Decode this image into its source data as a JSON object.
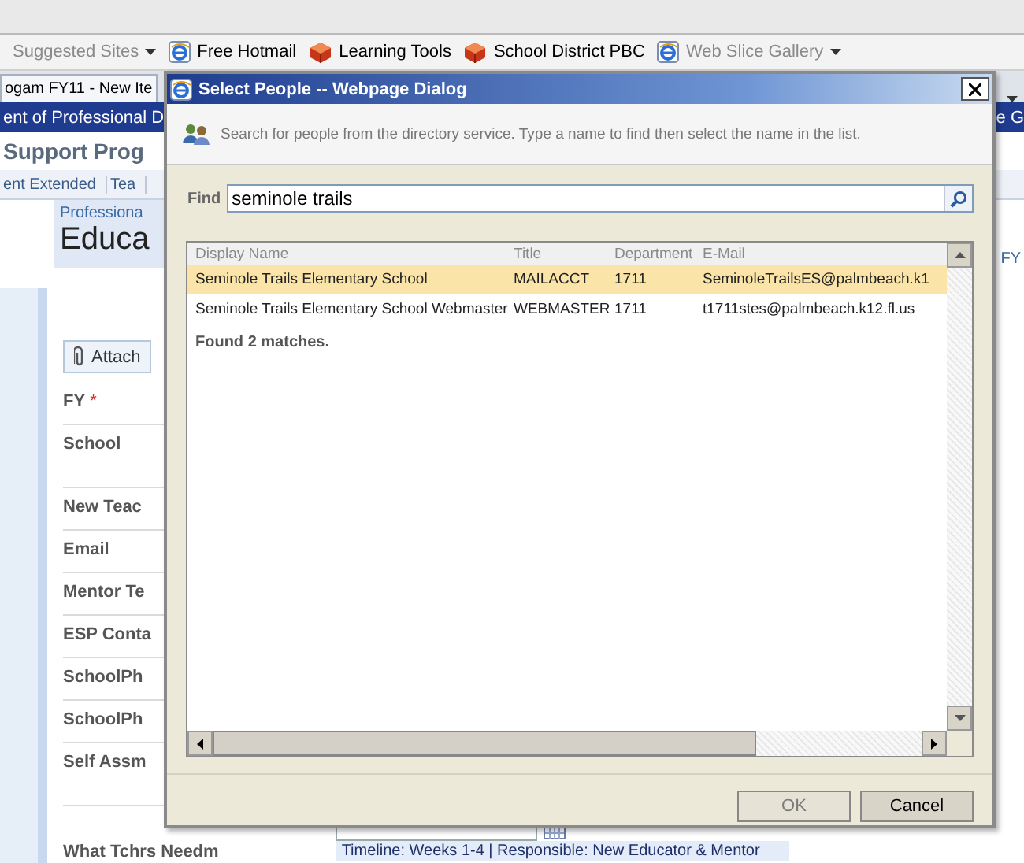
{
  "favorites_bar": {
    "items": [
      {
        "label": "Suggested Sites",
        "dimmed": true,
        "menu": true
      },
      {
        "label": "Free Hotmail",
        "dimmed": false,
        "kind": "browser",
        "menu": false
      },
      {
        "label": "Learning Tools",
        "dimmed": false,
        "kind": "cube",
        "menu": false
      },
      {
        "label": "School District PBC",
        "dimmed": false,
        "kind": "cube",
        "menu": false
      },
      {
        "label": "Web Slice Gallery",
        "dimmed": true,
        "kind": "browser",
        "menu": true
      }
    ]
  },
  "browser_tab": {
    "label": "ogam FY11 - New Ite"
  },
  "site_bar": {
    "left": "ent of Professional D",
    "right": "e G"
  },
  "page": {
    "heading": "Support Prog",
    "tabs": [
      "ent Extended",
      "Tea"
    ],
    "breadcrumb": "Professiona",
    "title": "Educa",
    "side_label": "FY",
    "attach_button": "Attach",
    "fields": [
      {
        "label": "FY",
        "required_mark": "*",
        "tall": false
      },
      {
        "label": "School",
        "tall": true
      },
      {
        "label": "New Teac",
        "tall": false
      },
      {
        "label": "Email",
        "tall": false
      },
      {
        "label": "Mentor Te",
        "tall": false
      },
      {
        "label": "ESP Conta",
        "tall": false
      },
      {
        "label": "SchoolPh",
        "tall": false
      },
      {
        "label": "SchoolPh",
        "tall": false
      },
      {
        "label": "Self Assm",
        "tall": true
      },
      {
        "label": "What Tchrs Needm",
        "tall": false
      }
    ],
    "timeline": "Timeline: Weeks 1-4 | Responsible: New Educator & Mentor"
  },
  "dialog": {
    "title": "Select People -- Webpage Dialog",
    "instruction": "Search for people from the directory service. Type a name to find then select the name in the list.",
    "find_label": "Find",
    "find_value": "seminole trails",
    "columns": [
      "Display Name",
      "Title",
      "Department",
      "E-Mail"
    ],
    "rows": [
      {
        "cells": [
          "Seminole Trails Elementary School",
          "MAILACCT",
          "1711",
          "SeminoleTrailsES@palmbeach.k1"
        ],
        "selected": true
      },
      {
        "cells": [
          "Seminole Trails Elementary School Webmaster",
          "WEBMASTER",
          "1711",
          "t1711stes@palmbeach.k12.fl.us"
        ],
        "selected": false
      }
    ],
    "status": "Found 2 matches.",
    "buttons": [
      {
        "label": "OK",
        "disabled": true
      },
      {
        "label": "Cancel",
        "disabled": false
      }
    ]
  }
}
